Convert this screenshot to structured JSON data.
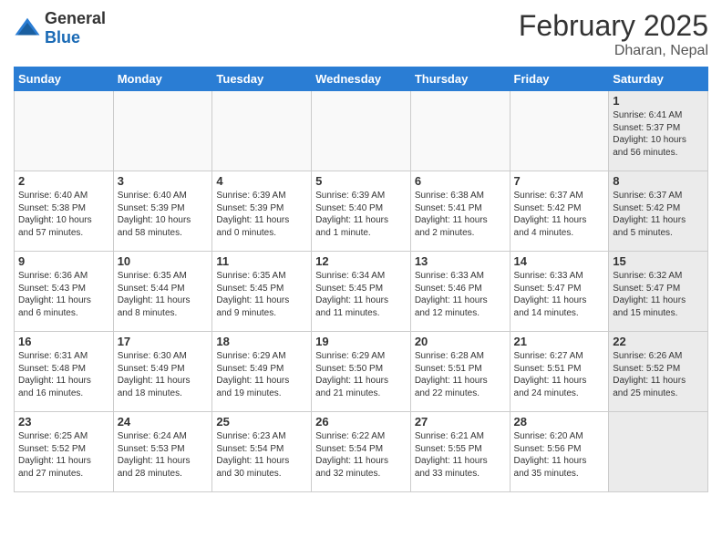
{
  "logo": {
    "general": "General",
    "blue": "Blue"
  },
  "header": {
    "title": "February 2025",
    "subtitle": "Dharan, Nepal"
  },
  "weekdays": [
    "Sunday",
    "Monday",
    "Tuesday",
    "Wednesday",
    "Thursday",
    "Friday",
    "Saturday"
  ],
  "days": [
    {
      "num": "",
      "info": "",
      "empty": true,
      "shaded": false
    },
    {
      "num": "",
      "info": "",
      "empty": true,
      "shaded": false
    },
    {
      "num": "",
      "info": "",
      "empty": true,
      "shaded": false
    },
    {
      "num": "",
      "info": "",
      "empty": true,
      "shaded": false
    },
    {
      "num": "",
      "info": "",
      "empty": true,
      "shaded": false
    },
    {
      "num": "",
      "info": "",
      "empty": true,
      "shaded": false
    },
    {
      "num": "1",
      "info": "Sunrise: 6:41 AM\nSunset: 5:37 PM\nDaylight: 10 hours\nand 56 minutes.",
      "empty": false,
      "shaded": true
    },
    {
      "num": "2",
      "info": "Sunrise: 6:40 AM\nSunset: 5:38 PM\nDaylight: 10 hours\nand 57 minutes.",
      "empty": false,
      "shaded": false
    },
    {
      "num": "3",
      "info": "Sunrise: 6:40 AM\nSunset: 5:39 PM\nDaylight: 10 hours\nand 58 minutes.",
      "empty": false,
      "shaded": false
    },
    {
      "num": "4",
      "info": "Sunrise: 6:39 AM\nSunset: 5:39 PM\nDaylight: 11 hours\nand 0 minutes.",
      "empty": false,
      "shaded": false
    },
    {
      "num": "5",
      "info": "Sunrise: 6:39 AM\nSunset: 5:40 PM\nDaylight: 11 hours\nand 1 minute.",
      "empty": false,
      "shaded": false
    },
    {
      "num": "6",
      "info": "Sunrise: 6:38 AM\nSunset: 5:41 PM\nDaylight: 11 hours\nand 2 minutes.",
      "empty": false,
      "shaded": false
    },
    {
      "num": "7",
      "info": "Sunrise: 6:37 AM\nSunset: 5:42 PM\nDaylight: 11 hours\nand 4 minutes.",
      "empty": false,
      "shaded": false
    },
    {
      "num": "8",
      "info": "Sunrise: 6:37 AM\nSunset: 5:42 PM\nDaylight: 11 hours\nand 5 minutes.",
      "empty": false,
      "shaded": true
    },
    {
      "num": "9",
      "info": "Sunrise: 6:36 AM\nSunset: 5:43 PM\nDaylight: 11 hours\nand 6 minutes.",
      "empty": false,
      "shaded": false
    },
    {
      "num": "10",
      "info": "Sunrise: 6:35 AM\nSunset: 5:44 PM\nDaylight: 11 hours\nand 8 minutes.",
      "empty": false,
      "shaded": false
    },
    {
      "num": "11",
      "info": "Sunrise: 6:35 AM\nSunset: 5:45 PM\nDaylight: 11 hours\nand 9 minutes.",
      "empty": false,
      "shaded": false
    },
    {
      "num": "12",
      "info": "Sunrise: 6:34 AM\nSunset: 5:45 PM\nDaylight: 11 hours\nand 11 minutes.",
      "empty": false,
      "shaded": false
    },
    {
      "num": "13",
      "info": "Sunrise: 6:33 AM\nSunset: 5:46 PM\nDaylight: 11 hours\nand 12 minutes.",
      "empty": false,
      "shaded": false
    },
    {
      "num": "14",
      "info": "Sunrise: 6:33 AM\nSunset: 5:47 PM\nDaylight: 11 hours\nand 14 minutes.",
      "empty": false,
      "shaded": false
    },
    {
      "num": "15",
      "info": "Sunrise: 6:32 AM\nSunset: 5:47 PM\nDaylight: 11 hours\nand 15 minutes.",
      "empty": false,
      "shaded": true
    },
    {
      "num": "16",
      "info": "Sunrise: 6:31 AM\nSunset: 5:48 PM\nDaylight: 11 hours\nand 16 minutes.",
      "empty": false,
      "shaded": false
    },
    {
      "num": "17",
      "info": "Sunrise: 6:30 AM\nSunset: 5:49 PM\nDaylight: 11 hours\nand 18 minutes.",
      "empty": false,
      "shaded": false
    },
    {
      "num": "18",
      "info": "Sunrise: 6:29 AM\nSunset: 5:49 PM\nDaylight: 11 hours\nand 19 minutes.",
      "empty": false,
      "shaded": false
    },
    {
      "num": "19",
      "info": "Sunrise: 6:29 AM\nSunset: 5:50 PM\nDaylight: 11 hours\nand 21 minutes.",
      "empty": false,
      "shaded": false
    },
    {
      "num": "20",
      "info": "Sunrise: 6:28 AM\nSunset: 5:51 PM\nDaylight: 11 hours\nand 22 minutes.",
      "empty": false,
      "shaded": false
    },
    {
      "num": "21",
      "info": "Sunrise: 6:27 AM\nSunset: 5:51 PM\nDaylight: 11 hours\nand 24 minutes.",
      "empty": false,
      "shaded": false
    },
    {
      "num": "22",
      "info": "Sunrise: 6:26 AM\nSunset: 5:52 PM\nDaylight: 11 hours\nand 25 minutes.",
      "empty": false,
      "shaded": true
    },
    {
      "num": "23",
      "info": "Sunrise: 6:25 AM\nSunset: 5:52 PM\nDaylight: 11 hours\nand 27 minutes.",
      "empty": false,
      "shaded": false
    },
    {
      "num": "24",
      "info": "Sunrise: 6:24 AM\nSunset: 5:53 PM\nDaylight: 11 hours\nand 28 minutes.",
      "empty": false,
      "shaded": false
    },
    {
      "num": "25",
      "info": "Sunrise: 6:23 AM\nSunset: 5:54 PM\nDaylight: 11 hours\nand 30 minutes.",
      "empty": false,
      "shaded": false
    },
    {
      "num": "26",
      "info": "Sunrise: 6:22 AM\nSunset: 5:54 PM\nDaylight: 11 hours\nand 32 minutes.",
      "empty": false,
      "shaded": false
    },
    {
      "num": "27",
      "info": "Sunrise: 6:21 AM\nSunset: 5:55 PM\nDaylight: 11 hours\nand 33 minutes.",
      "empty": false,
      "shaded": false
    },
    {
      "num": "28",
      "info": "Sunrise: 6:20 AM\nSunset: 5:56 PM\nDaylight: 11 hours\nand 35 minutes.",
      "empty": false,
      "shaded": false
    },
    {
      "num": "",
      "info": "",
      "empty": true,
      "shaded": true
    }
  ]
}
